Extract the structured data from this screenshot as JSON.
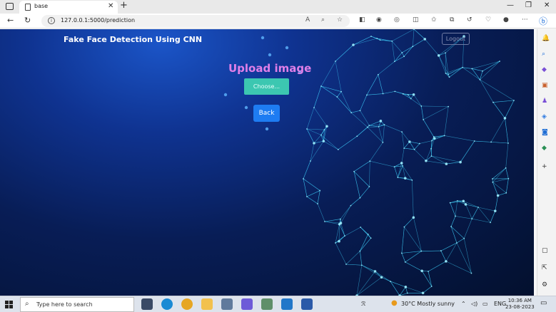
{
  "browser": {
    "tab_title": "base",
    "tab_close": "✕",
    "new_tab": "+",
    "url": "127.0.0.1:5000/prediction",
    "win_min": "—",
    "win_max": "❐",
    "win_close": "✕"
  },
  "page": {
    "brand": "Fake Face Detection Using CNN",
    "logout_label": "Logout",
    "upload_title": "Upload image",
    "choose_label": "Choose...",
    "back_label": "Back"
  },
  "taskbar": {
    "search_placeholder": "Type here to search",
    "weather": "30°C  Mostly sunny",
    "lang": "ENG",
    "time": "10:36 AM",
    "date": "23-08-2023"
  },
  "colors": {
    "upload_title": "#e07fe8",
    "choose_button": "#3cc7b1",
    "back_button": "#1e7cf2",
    "face_lines": "#3fd6ff"
  }
}
